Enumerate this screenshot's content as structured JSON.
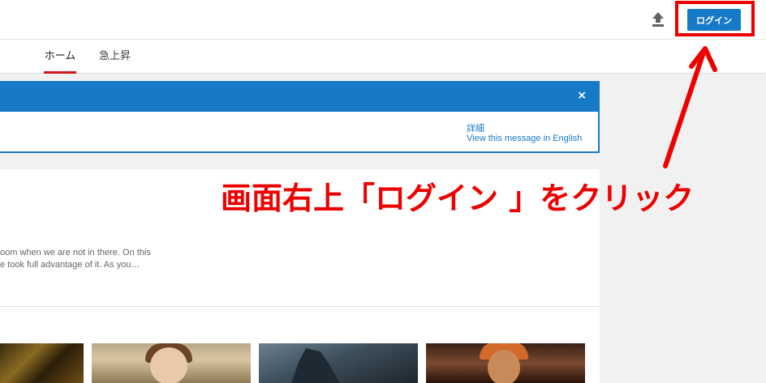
{
  "header": {
    "upload_icon": "upload-icon",
    "login_label": "ログイン"
  },
  "tabs": [
    {
      "label": "ホーム",
      "active": true
    },
    {
      "label": "急上昇",
      "active": false
    }
  ],
  "notice": {
    "close_label": "×",
    "details_link": "詳細",
    "english_link": "View this message in English"
  },
  "feed": {
    "snippet_line1": "oom when we are not in there. On this",
    "snippet_line2": "e took full advantage of it. As you…"
  },
  "annotation": {
    "text": "画面右上「ログイン 」をクリック",
    "color": "#ee0000"
  },
  "colors": {
    "accent": "#167ac6",
    "tab_underline": "#cc181e"
  }
}
